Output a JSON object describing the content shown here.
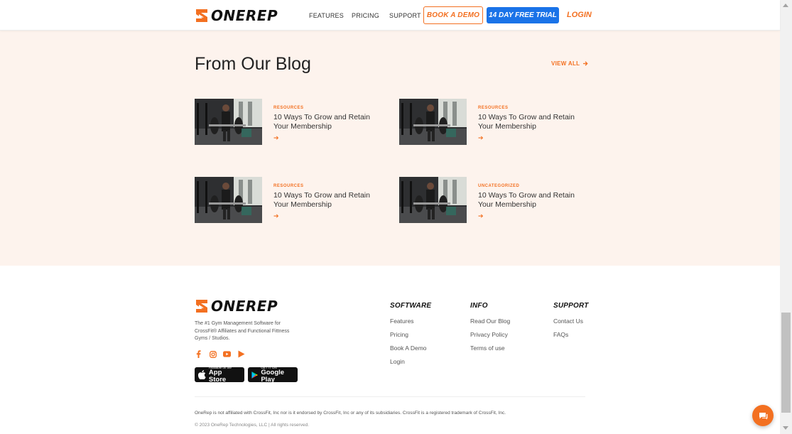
{
  "brand": {
    "name": "ONEREP",
    "accent": "#f37021",
    "blue": "#1a73e8"
  },
  "nav": {
    "items": [
      "FEATURES",
      "PRICING",
      "SUPPORT"
    ],
    "book_demo": "BOOK A DEMO",
    "free_trial": "14 DAY FREE TRIAL",
    "login": "LOGIN"
  },
  "blog": {
    "title": "From Our Blog",
    "view_all": "VIEW ALL",
    "posts": [
      {
        "category": "RESOURCES",
        "title": "10 Ways To Grow and Retain Your Membership",
        "arrow": "➔"
      },
      {
        "category": "RESOURCES",
        "title": "10 Ways To Grow and Retain Your Membership",
        "arrow": "➔"
      },
      {
        "category": "RESOURCES",
        "title": "10 Ways To Grow and Retain Your Membership",
        "arrow": "➔"
      },
      {
        "category": "UNCATEGORIZED",
        "title": "10 Ways To Grow and Retain Your Membership",
        "arrow": "➔"
      }
    ]
  },
  "footer": {
    "tagline": "The #1 Gym Management Software for CrossFit® Affiliates and Functional Fittness Gyms / Studios.",
    "social_icons": [
      "facebook-icon",
      "instagram-icon",
      "youtube-icon",
      "play-icon"
    ],
    "app_store": {
      "small": "Available on the",
      "big": "App Store"
    },
    "google_play": {
      "small": "GET IT ON",
      "big": "Google Play"
    },
    "columns": [
      {
        "heading": "SOFTWARE",
        "links": [
          "Features",
          "Pricing",
          "Book A Demo",
          "Login"
        ]
      },
      {
        "heading": "INFO",
        "links": [
          "Read Our Blog",
          "Privacy Policy",
          "Terms of use"
        ]
      },
      {
        "heading": "SUPPORT",
        "links": [
          "Contact Us",
          "FAQs"
        ]
      }
    ],
    "disclaimer": "OneRep is not affiliated with CrossFit, Inc nor is it endorsed by CrossFit, Inc or any of its subsidiaries. CrossFit is a registered trademark of CrossFit, Inc.",
    "copyright": "© 2023 OneRep Technologies, LLC | All rights reserved."
  }
}
